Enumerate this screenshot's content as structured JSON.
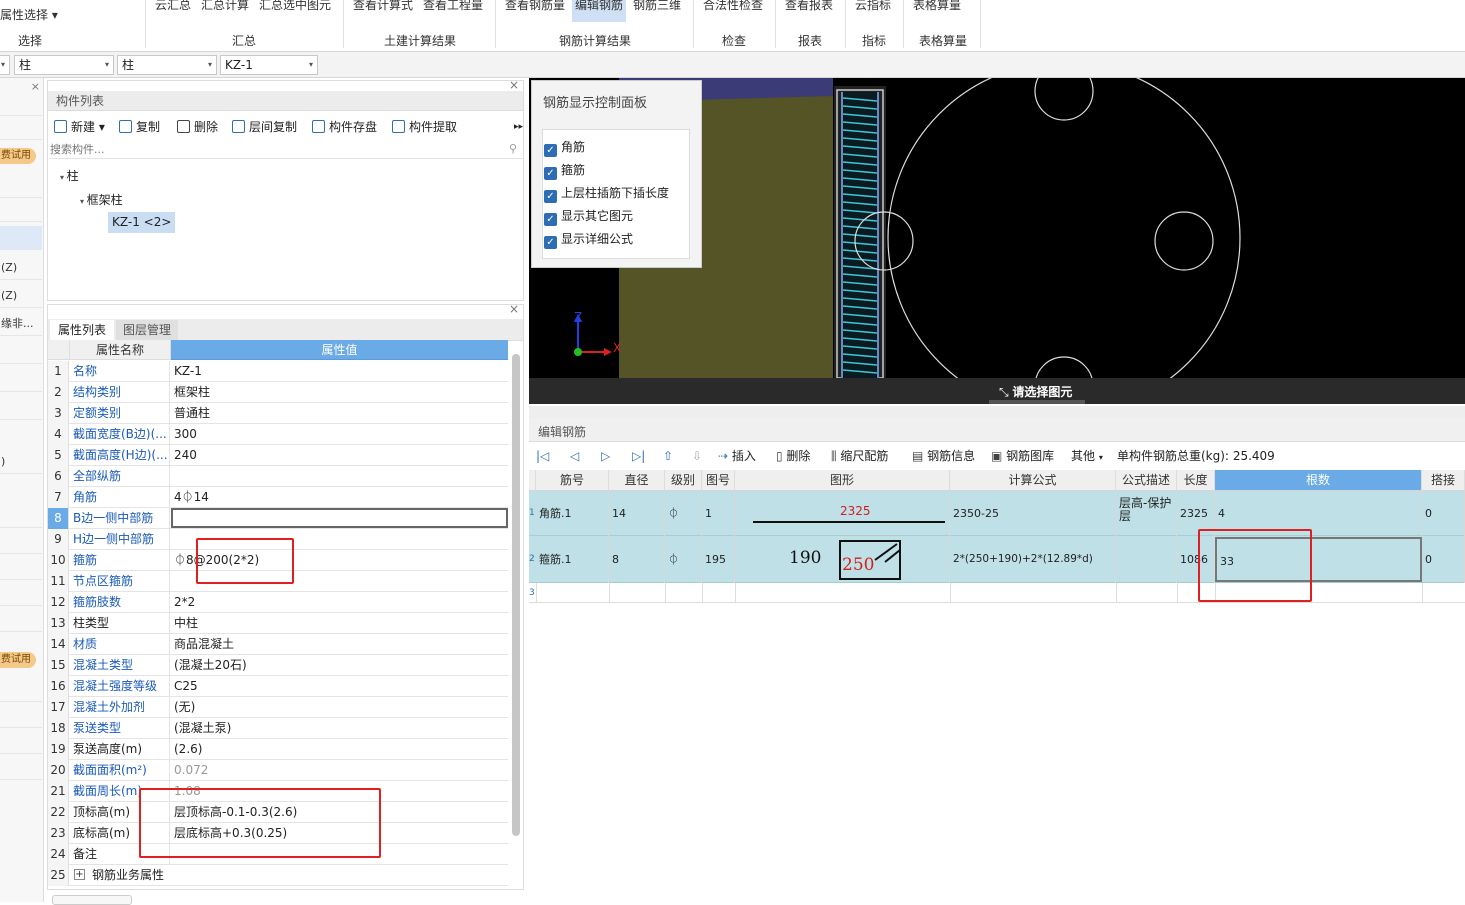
{
  "ribbon": {
    "left_label": "属性选择",
    "buttons": [
      "云汇总",
      "汇总计算",
      "汇总选中图元",
      "查看计算式",
      "查看工程量",
      "查看钢筋量",
      "编辑钢筋",
      "钢筋三维",
      "合法性检查",
      "查看报表",
      "云指标",
      "表格算量"
    ],
    "groups": [
      "选择",
      "汇总",
      "土建计算结果",
      "钢筋计算结果",
      "检查",
      "报表",
      "指标",
      "表格算量"
    ]
  },
  "combobar": {
    "c1": "柱",
    "c2": "柱",
    "c3": "KZ-1"
  },
  "leftstrip": {
    "items": [
      "费试用",
      "(Z)",
      "(Z)",
      "缘非...",
      ")",
      "费试用"
    ]
  },
  "component_list": {
    "title": "构件列表",
    "toolbar": {
      "new": "新建",
      "copy": "复制",
      "delete": "删除",
      "floor_copy": "层间复制",
      "save": "构件存盘",
      "extract": "构件提取"
    },
    "search_placeholder": "搜索构件...",
    "tree": {
      "root": "柱",
      "child": "框架柱",
      "leaf": "KZ-1 <2>"
    }
  },
  "property_panel": {
    "tabs": [
      "属性列表",
      "图层管理"
    ],
    "header_name": "属性名称",
    "header_value": "属性值",
    "rows": [
      {
        "n": "1",
        "name": "名称",
        "value": "KZ-1",
        "blue": true
      },
      {
        "n": "2",
        "name": "结构类别",
        "value": "框架柱",
        "blue": true
      },
      {
        "n": "3",
        "name": "定额类别",
        "value": "普通柱",
        "blue": true
      },
      {
        "n": "4",
        "name": "截面宽度(B边)(...",
        "value": "300",
        "blue": true
      },
      {
        "n": "5",
        "name": "截面高度(H边)(...",
        "value": "240",
        "blue": true
      },
      {
        "n": "6",
        "name": "全部纵筋",
        "value": "",
        "blue": true
      },
      {
        "n": "7",
        "name": "角筋",
        "value": "4⏀14",
        "blue": true
      },
      {
        "n": "8",
        "name": "B边一侧中部筋",
        "value": "",
        "blue": true
      },
      {
        "n": "9",
        "name": "H边一侧中部筋",
        "value": "",
        "blue": true
      },
      {
        "n": "10",
        "name": "箍筋",
        "value": "⏀8@200(2*2)",
        "blue": true
      },
      {
        "n": "11",
        "name": "节点区箍筋",
        "value": "",
        "blue": true
      },
      {
        "n": "12",
        "name": "箍筋肢数",
        "value": "2*2",
        "blue": true
      },
      {
        "n": "13",
        "name": "柱类型",
        "value": "中柱",
        "blue": false
      },
      {
        "n": "14",
        "name": "材质",
        "value": "商品混凝土",
        "blue": true
      },
      {
        "n": "15",
        "name": "混凝土类型",
        "value": "(混凝土20石)",
        "blue": true
      },
      {
        "n": "16",
        "name": "混凝土强度等级",
        "value": "C25",
        "blue": true
      },
      {
        "n": "17",
        "name": "混凝土外加剂",
        "value": "(无)",
        "blue": true
      },
      {
        "n": "18",
        "name": "泵送类型",
        "value": "(混凝土泵)",
        "blue": true
      },
      {
        "n": "19",
        "name": "泵送高度(m)",
        "value": "(2.6)",
        "blue": false
      },
      {
        "n": "20",
        "name": "截面面积(m²)",
        "value": "0.072",
        "blue": true,
        "gray": true
      },
      {
        "n": "21",
        "name": "截面周长(m)",
        "value": "1.08",
        "blue": true,
        "gray": true
      },
      {
        "n": "22",
        "name": "顶标高(m)",
        "value": "层顶标高-0.1-0.3(2.6)",
        "blue": false
      },
      {
        "n": "23",
        "name": "底标高(m)",
        "value": "层底标高+0.3(0.25)",
        "blue": false
      },
      {
        "n": "24",
        "name": "备注",
        "value": "",
        "blue": false
      },
      {
        "n": "25",
        "name": "钢筋业务属性",
        "value": "",
        "blue": false
      }
    ]
  },
  "viewport": {
    "hint": "请选择图元",
    "axis_x": "X",
    "axis_z": "Z"
  },
  "control_panel": {
    "title": "钢筋显示控制面板",
    "options": [
      "角筋",
      "箍筋",
      "上层柱插筋下插长度",
      "显示其它图元",
      "显示详细公式"
    ]
  },
  "edit_rebar": {
    "title": "编辑钢筋",
    "toolbar": {
      "insert": "插入",
      "delete": "删除",
      "scale": "缩尺配筋",
      "info": "钢筋信息",
      "library": "钢筋图库",
      "other": "其他",
      "total_label": "单构件钢筋总重(kg):",
      "total_value": "25.409"
    },
    "headers": [
      "筋号",
      "直径(mm)",
      "级别",
      "图号",
      "图形",
      "计算公式",
      "公式描述",
      "长度",
      "根数",
      "搭接"
    ],
    "rows": [
      {
        "idx": "1",
        "name": "角筋.1",
        "dia": "14",
        "grade": "⏀",
        "fig": "1",
        "shape_len": "2325",
        "formula": "2350-25",
        "desc": "层高-保护层",
        "length": "2325",
        "count": "4",
        "lap": "0"
      },
      {
        "idx": "2",
        "name": "箍筋.1",
        "dia": "8",
        "grade": "⏀",
        "fig": "195",
        "shape_a": "190",
        "shape_b": "250",
        "formula": "2*(250+190)+2*(12.89*d)",
        "desc": "",
        "length": "1086",
        "count": "33",
        "lap": "0"
      },
      {
        "idx": "3"
      }
    ]
  }
}
